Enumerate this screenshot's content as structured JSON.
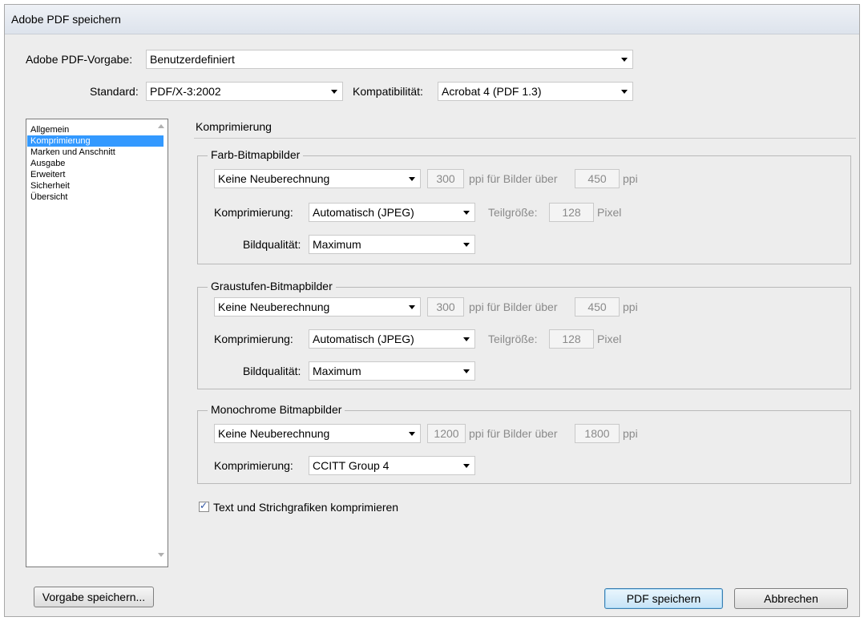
{
  "window": {
    "title": "Adobe PDF speichern"
  },
  "top": {
    "preset_label": "Adobe PDF-Vorgabe:",
    "preset_value": "Benutzerdefiniert",
    "standard_label": "Standard:",
    "standard_value": "PDF/X-3:2002",
    "compat_label": "Kompatibilität:",
    "compat_value": "Acrobat 4 (PDF 1.3)"
  },
  "sidebar": {
    "items": [
      {
        "label": "Allgemein"
      },
      {
        "label": "Komprimierung",
        "selected": true
      },
      {
        "label": "Marken und Anschnitt"
      },
      {
        "label": "Ausgabe"
      },
      {
        "label": "Erweitert"
      },
      {
        "label": "Sicherheit"
      },
      {
        "label": "Übersicht"
      }
    ]
  },
  "section": {
    "title": "Komprimierung"
  },
  "color": {
    "legend": "Farb-Bitmapbilder",
    "resample": "Keine Neuberechnung",
    "ppi": "300",
    "ppi_for_label": "ppi für Bilder über",
    "above": "450",
    "ppi_unit": "ppi",
    "compression_label": "Komprimierung:",
    "compression": "Automatisch (JPEG)",
    "tile_label": "Teilgröße:",
    "tile": "128",
    "tile_unit": "Pixel",
    "quality_label": "Bildqualität:",
    "quality": "Maximum"
  },
  "gray": {
    "legend": "Graustufen-Bitmapbilder",
    "resample": "Keine Neuberechnung",
    "ppi": "300",
    "ppi_for_label": "ppi für Bilder über",
    "above": "450",
    "ppi_unit": "ppi",
    "compression_label": "Komprimierung:",
    "compression": "Automatisch (JPEG)",
    "tile_label": "Teilgröße:",
    "tile": "128",
    "tile_unit": "Pixel",
    "quality_label": "Bildqualität:",
    "quality": "Maximum"
  },
  "mono": {
    "legend": "Monochrome Bitmapbilder",
    "resample": "Keine Neuberechnung",
    "ppi": "1200",
    "ppi_for_label": "ppi für Bilder über",
    "above": "1800",
    "ppi_unit": "ppi",
    "compression_label": "Komprimierung:",
    "compression": "CCITT Group 4"
  },
  "text_compress": {
    "label": "Text und Strichgrafiken komprimieren",
    "checked": true
  },
  "buttons": {
    "save_preset": "Vorgabe speichern...",
    "save_pdf": "PDF speichern",
    "cancel": "Abbrechen"
  }
}
